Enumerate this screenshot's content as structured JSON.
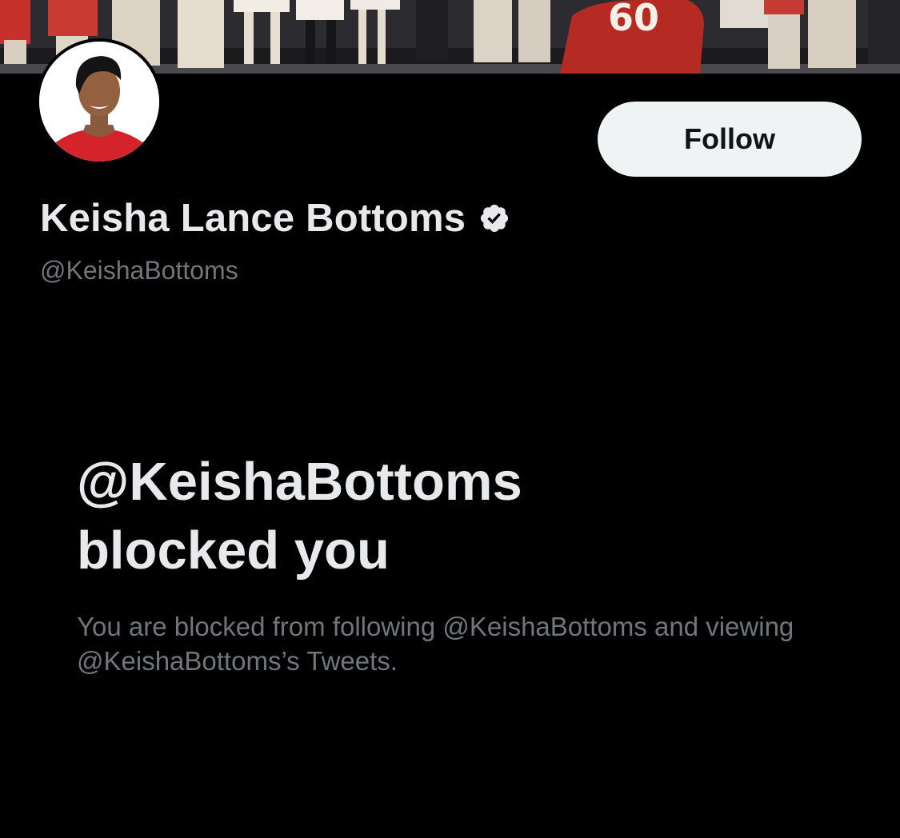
{
  "profile": {
    "display_name": "Keisha Lance Bottoms",
    "handle": "@KeishaBottoms",
    "verified_icon": "verified-badge-icon",
    "follow_label": "Follow"
  },
  "blocked": {
    "title_line1": "@KeishaBottoms",
    "title_line2": "blocked you",
    "description": "You are blocked from following @KeishaBottoms and viewing @KeishaBottoms’s Tweets."
  },
  "colors": {
    "background": "#000000",
    "primary_text": "#e7e9ea",
    "secondary_text": "#71767b",
    "follow_button_bg": "#eff3f4",
    "follow_button_text": "#0f1419"
  }
}
